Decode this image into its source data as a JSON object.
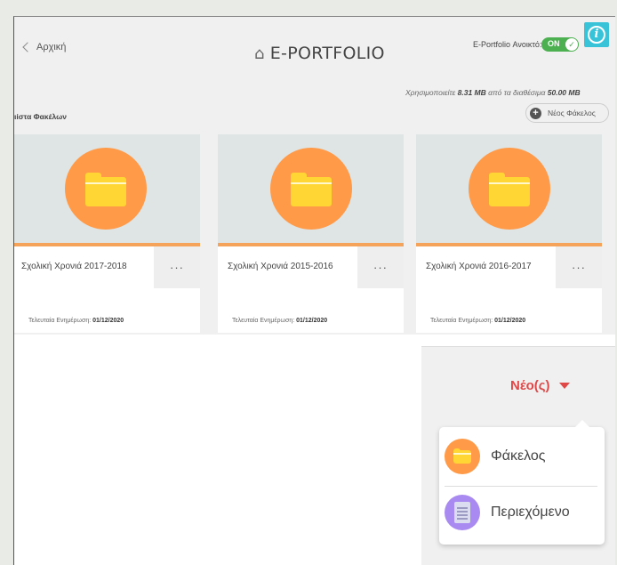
{
  "header": {
    "back_label": "Αρχική",
    "title": "E-PORTFOLIO",
    "toggle_label": "E-Portfolio Ανοικτό:",
    "toggle_state": "ON",
    "info_glyph": "i"
  },
  "usage": {
    "prefix": "Χρησιμοποιείτε",
    "used": "8.31 MB",
    "middle": "από τα διαθέσιμα",
    "total": "50.00 MB"
  },
  "folders": {
    "section_title": "ιίστα Φακέλων",
    "new_folder_label": "Νέος Φάκελος",
    "update_label": "Τελευταία Ενημέρωση:",
    "menu_glyph": "···",
    "items": [
      {
        "name": "Σχολική Χρονιά 2017-2018",
        "updated": "01/12/2020"
      },
      {
        "name": "Σχολική Χρονιά 2015-2016",
        "updated": "01/12/2020"
      },
      {
        "name": "Σχολική Χρονιά 2016-2017",
        "updated": "01/12/2020"
      }
    ]
  },
  "new_menu": {
    "button_label": "Νέο(ς)",
    "options": [
      {
        "label": "Φάκελος",
        "icon": "folder-icon"
      },
      {
        "label": "Περιεχόμενο",
        "icon": "document-icon"
      }
    ]
  },
  "colors": {
    "accent_orange": "#ff9a48",
    "folder_yellow": "#ffd633",
    "toggle_green": "#4caf50",
    "new_red": "#e04848",
    "info_teal": "#39c3d9"
  }
}
